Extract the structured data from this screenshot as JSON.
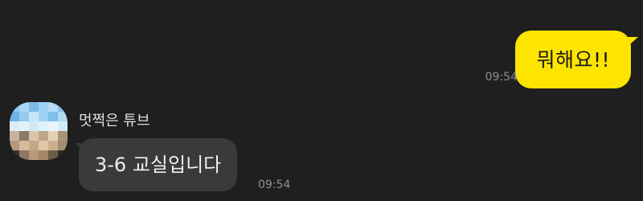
{
  "messages": {
    "outgoing": {
      "text": "뭐해요!!",
      "time": "09:54"
    },
    "incoming": {
      "sender": "멋쩍은 튜브",
      "text": "3-6 교실입니다",
      "time": "09:54"
    }
  },
  "colors": {
    "background": "#1f1f1f",
    "outgoing_bubble": "#fee500",
    "incoming_bubble": "#3a3a3a",
    "timestamp": "#8f8f8f"
  },
  "avatar": {
    "style": "pixelated-photo"
  }
}
